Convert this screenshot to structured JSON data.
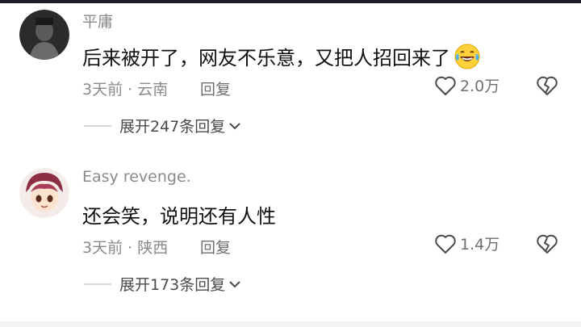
{
  "comments": [
    {
      "author": "平庸",
      "text": "后来被开了，网友不乐意，又把人招回来了",
      "emoji": "laughing-tears-icon",
      "meta": "3天前 · 云南",
      "reply_label": "回复",
      "like_count": "2.0万",
      "expand_label": "展开247条回复"
    },
    {
      "author": "Easy revenge.",
      "text": "还会笑，说明还有人性",
      "meta": "3天前 · 陕西",
      "reply_label": "回复",
      "like_count": "1.4万",
      "expand_label": "展开173条回复"
    }
  ],
  "colors": {
    "muted": "#8a8a8a",
    "text": "#111111",
    "divider": "#d8d8d8"
  }
}
